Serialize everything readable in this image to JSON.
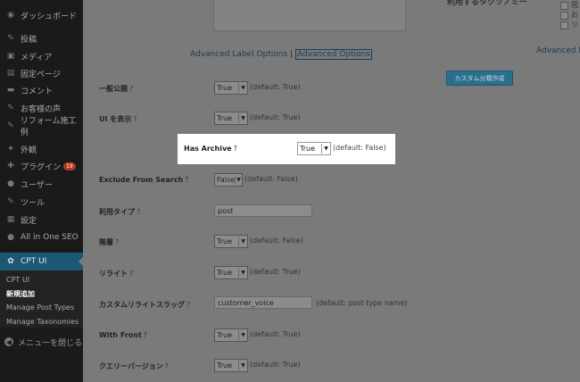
{
  "sidebar": {
    "items": [
      {
        "icon": "dashboard-icon",
        "glyph": "◉",
        "label": "ダッシュボード"
      },
      {
        "icon": "pin-icon",
        "glyph": "✎",
        "label": "投稿"
      },
      {
        "icon": "media-icon",
        "glyph": "▣",
        "label": "メディア"
      },
      {
        "icon": "page-icon",
        "glyph": "▤",
        "label": "固定ページ"
      },
      {
        "icon": "comment-icon",
        "glyph": "▬",
        "label": "コメント"
      },
      {
        "icon": "pin-icon",
        "glyph": "✎",
        "label": "お客様の声"
      },
      {
        "icon": "pin-icon",
        "glyph": "✎",
        "label": "リフォーム施工例"
      },
      {
        "icon": "appearance-icon",
        "glyph": "✦",
        "label": "外観"
      },
      {
        "icon": "plugin-icon",
        "glyph": "✚",
        "label": "プラグイン",
        "badge": "19"
      },
      {
        "icon": "user-icon",
        "glyph": "●",
        "label": "ユーザー"
      },
      {
        "icon": "tools-icon",
        "glyph": "✎",
        "label": "ツール"
      },
      {
        "icon": "settings-icon",
        "glyph": "▦",
        "label": "設定"
      },
      {
        "icon": "seo-icon",
        "glyph": "●",
        "label": "All in One SEO"
      }
    ],
    "active": {
      "icon": "gear-icon",
      "glyph": "✿",
      "label": "CPT UI"
    },
    "submenu": [
      "CPT UI",
      "新規追加",
      "Manage Post Types",
      "Manage Taxonomies"
    ],
    "collapse": {
      "glyph": "◀",
      "label": "メニューを閉じる"
    }
  },
  "right_panel": {
    "heading": "利用するタクソノミー",
    "checks": [
      "固",
      "お",
      "リ"
    ],
    "advanced_link": "Advanced La",
    "add_button": "カスタム分類作成"
  },
  "links": {
    "label_options": "Advanced Label Options",
    "separator": "|",
    "advanced_options": "Advanced Options"
  },
  "rows": [
    {
      "label": "一般公開",
      "value": "True",
      "hint": "(default: True)"
    },
    {
      "label": "UI を表示",
      "value": "True",
      "hint": "(default: True)"
    },
    {
      "label": "Has Archive",
      "value": "True",
      "hint": "(default: False)"
    },
    {
      "label": "Exclude From Search",
      "value": "False",
      "hint": "(default: False)"
    },
    {
      "label": "利用タイプ",
      "value": "post",
      "hint": ""
    },
    {
      "label": "階層",
      "value": "True",
      "hint": "(default: False)"
    },
    {
      "label": "リライト",
      "value": "True",
      "hint": "(default: True)"
    },
    {
      "label": "カスタムリライトスラッグ",
      "value": "customer_voice",
      "hint": "(default: post type name)"
    },
    {
      "label": "With Front",
      "value": "True",
      "hint": "(default: True)"
    },
    {
      "label": "クエリーバージョン",
      "value": "True",
      "hint": "(default: True)"
    }
  ],
  "help_marker": "?",
  "dropdown_arrow": "▼"
}
